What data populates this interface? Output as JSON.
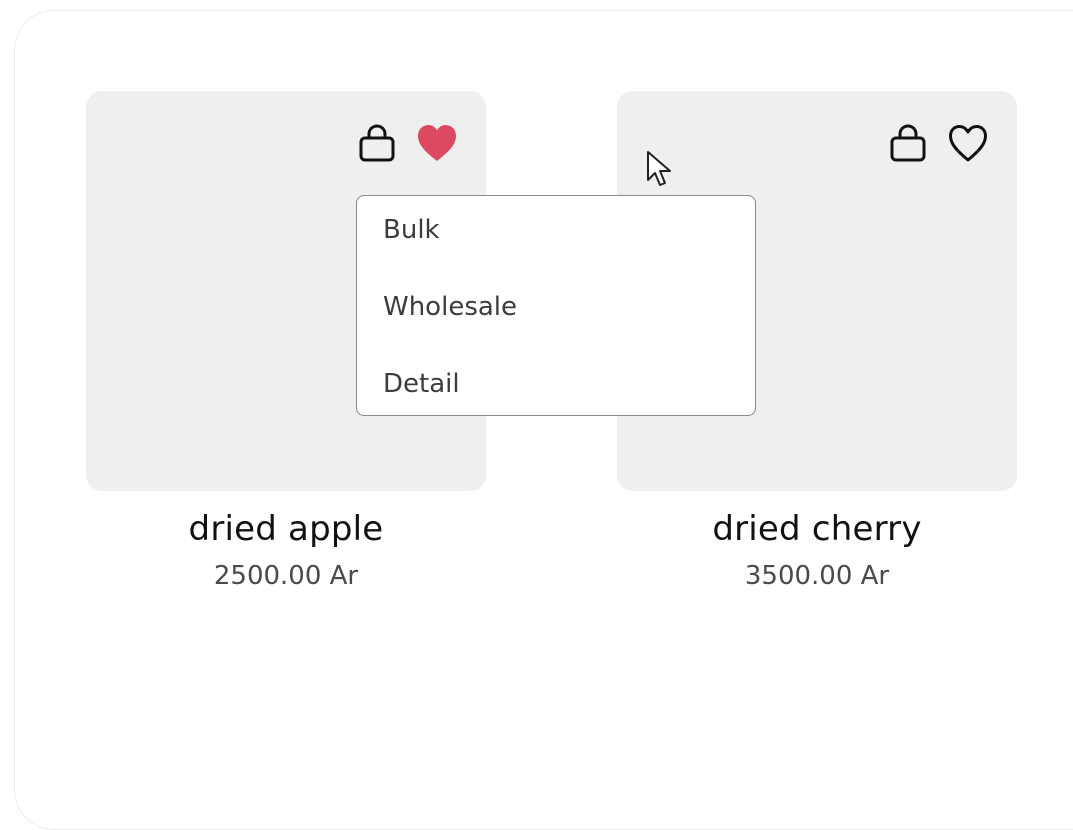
{
  "products": [
    {
      "name": "dried apple",
      "price": "2500.00 Ar",
      "favorited": true,
      "icons": {
        "cart": "shopping-bag-icon",
        "favorite": "heart-filled-icon"
      }
    },
    {
      "name": "dried cherry",
      "price": "3500.00 Ar",
      "favorited": false,
      "icons": {
        "cart": "shopping-bag-icon",
        "favorite": "heart-outline-icon"
      }
    }
  ],
  "dropdown": {
    "items": [
      "Bulk",
      "Wholesale",
      "Detail"
    ]
  },
  "colors": {
    "heart_active": "#dc4a62",
    "card_background": "#efefef",
    "text_primary": "#111111",
    "text_secondary": "#4a4a4a"
  }
}
